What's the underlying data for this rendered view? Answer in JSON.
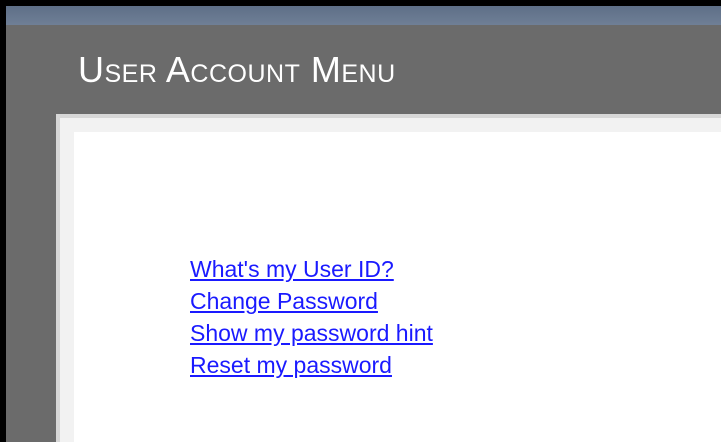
{
  "header": {
    "title": "User Account Menu"
  },
  "menu": {
    "links": [
      {
        "label": "What's my User ID?"
      },
      {
        "label": "Change Password"
      },
      {
        "label": "Show my password hint"
      },
      {
        "label": "Reset my password"
      }
    ]
  },
  "colors": {
    "frame": "#000000",
    "panel": "#6b6b6b",
    "top_band": "#6a7a92",
    "title_text": "#ffffff",
    "content_bg": "#ffffff",
    "link": "#1a1aff"
  }
}
